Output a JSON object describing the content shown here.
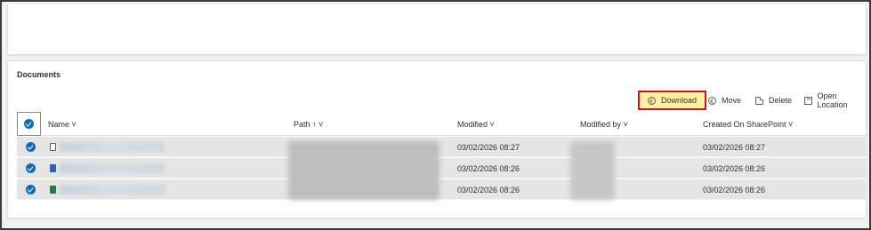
{
  "section": {
    "title": "Documents"
  },
  "commands": {
    "download": "Download",
    "move": "Move",
    "delete": "Delete",
    "open_location": "Open Location"
  },
  "columns": {
    "name": "Name ˅",
    "path": "Path ↑ ˅",
    "modified": "Modified ˅",
    "modified_by": "Modified by ˅",
    "created": "Created On SharePoint ˅"
  },
  "rows": [
    {
      "file_type": "text",
      "modified": "03/02/2026 08:27",
      "created": "03/02/2026 08:27"
    },
    {
      "file_type": "word",
      "modified": "03/02/2026 08:26",
      "created": "03/02/2026 08:26"
    },
    {
      "file_type": "excel",
      "modified": "03/02/2026 08:26",
      "created": "03/02/2026 08:26"
    }
  ],
  "colors": {
    "accent": "#0f6cbd",
    "highlight": "#fbf3a2",
    "highlight_border": "#d4161b"
  }
}
